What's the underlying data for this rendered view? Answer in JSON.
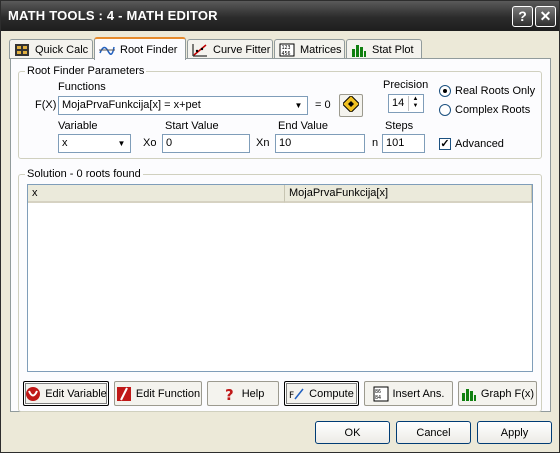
{
  "window": {
    "title": "MATH TOOLS : 4 - MATH EDITOR",
    "help_glyph": "?",
    "close_glyph": "✕"
  },
  "tabs": [
    {
      "label": "Quick Calc",
      "icon": "calculator-icon"
    },
    {
      "label": "Root Finder",
      "icon": "root-finder-icon",
      "active": true
    },
    {
      "label": "Curve Fitter",
      "icon": "curve-icon"
    },
    {
      "label": "Matrices",
      "icon": "matrix-icon"
    },
    {
      "label": "Stat Plot",
      "icon": "bar-chart-icon"
    }
  ],
  "params": {
    "group_label": "Root Finder Parameters",
    "functions_label": "Functions",
    "fx_label": "F(X)",
    "function_value": "MojaPrvaFunkcija[x] = x+pet",
    "equals_zero": "= 0",
    "precision_label": "Precision",
    "precision_value": "14",
    "variable_label": "Variable",
    "variable_value": "x",
    "xo_label": "Xo",
    "start_label": "Start Value",
    "start_value": "0",
    "xn_label": "Xn",
    "end_label": "End Value",
    "end_value": "10",
    "n_label": "n",
    "steps_label": "Steps",
    "steps_value": "101",
    "real_roots": "Real Roots Only",
    "complex_roots": "Complex Roots",
    "advanced": "Advanced",
    "advanced_check": "✓"
  },
  "solution": {
    "group_label": "Solution - 0 roots found",
    "columns": [
      "x",
      "MojaPrvaFunkcija[x]"
    ]
  },
  "actions": {
    "edit_variable": "Edit Variable",
    "edit_function": "Edit Function",
    "help": "Help",
    "compute": "Compute",
    "insert_ans": "Insert Ans.",
    "graph": "Graph F(x)"
  },
  "dialog": {
    "ok": "OK",
    "cancel": "Cancel",
    "apply": "Apply"
  },
  "colors": {
    "accent_tab": "#e68b2c",
    "title_bar": "#2b2b2b",
    "field_border": "#7f9db9"
  }
}
